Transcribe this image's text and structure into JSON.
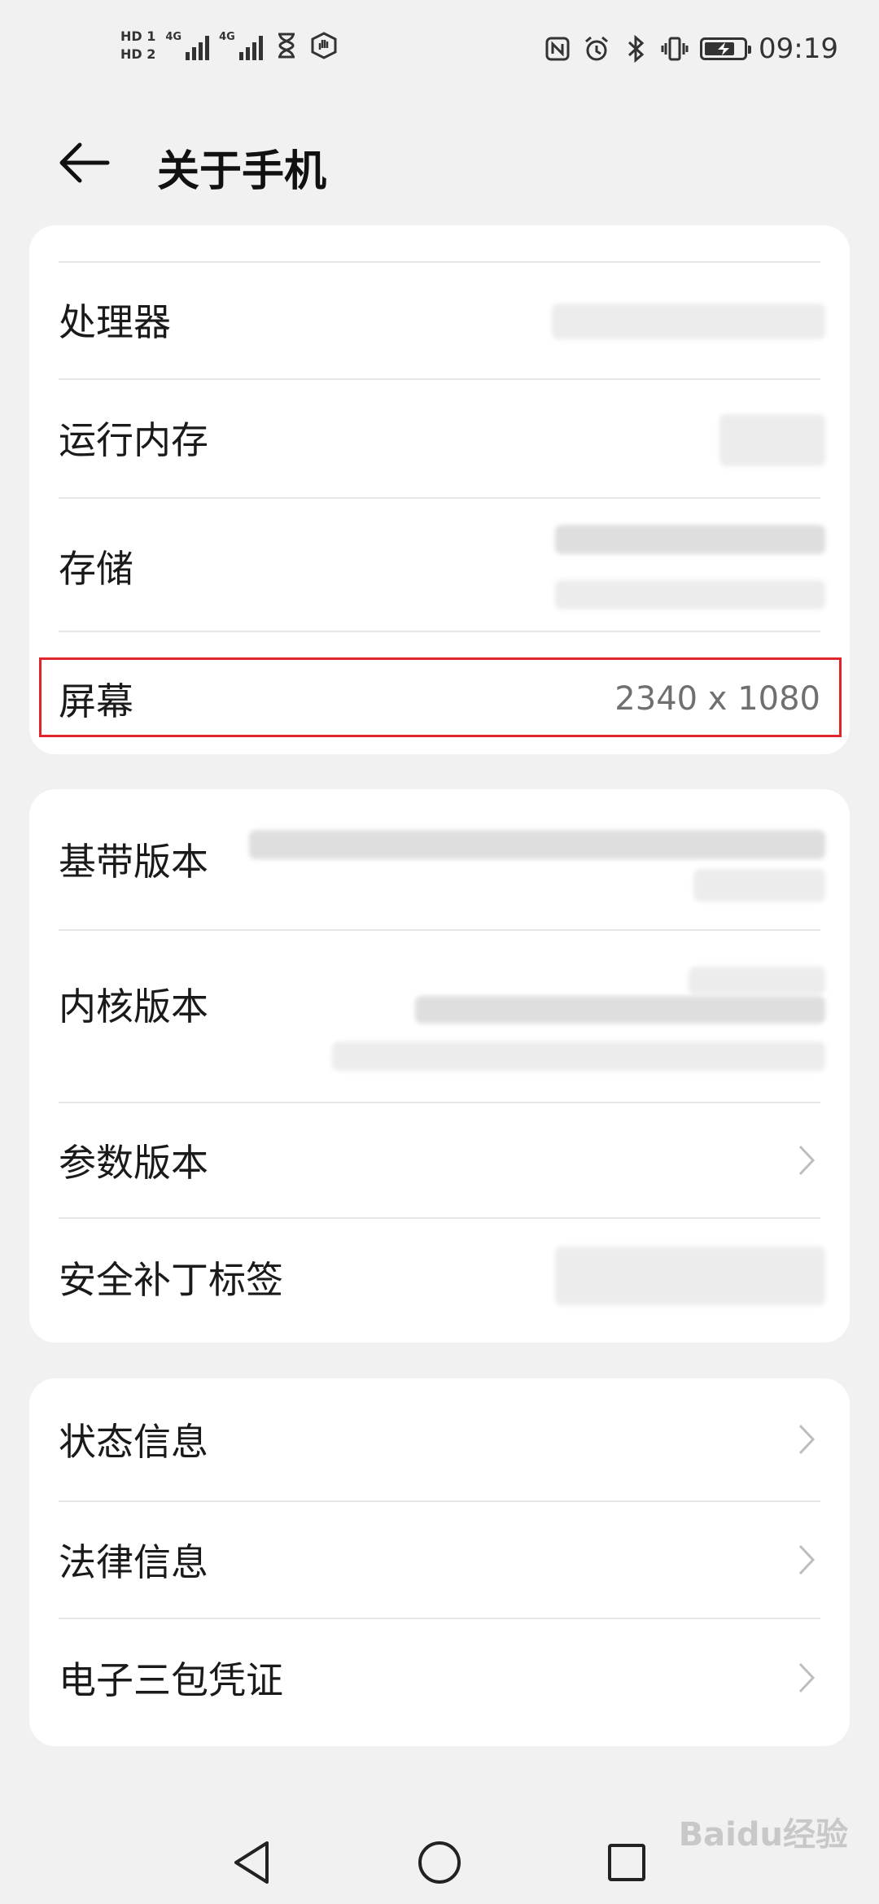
{
  "status_bar": {
    "sim1": "HD 1",
    "sim2": "HD 2",
    "net1": "4G",
    "net2": "4G",
    "time": "09:19",
    "icons": [
      "hourglass-icon",
      "hand-icon",
      "nfc-icon",
      "alarm-icon",
      "bluetooth-icon",
      "vibrate-icon",
      "battery-charging-icon"
    ]
  },
  "header": {
    "title": "关于手机",
    "back_icon": "arrow-left-icon"
  },
  "card1": {
    "items": [
      {
        "label": "处理器"
      },
      {
        "label": "运行内存"
      },
      {
        "label": "存储"
      },
      {
        "label": "屏幕",
        "value": "2340 x 1080"
      }
    ]
  },
  "card2": {
    "items": [
      {
        "label": "基带版本"
      },
      {
        "label": "内核版本"
      },
      {
        "label": "参数版本",
        "has_chevron": true
      },
      {
        "label": "安全补丁标签"
      }
    ]
  },
  "card3": {
    "items": [
      {
        "label": "状态信息",
        "has_chevron": true
      },
      {
        "label": "法律信息",
        "has_chevron": true
      },
      {
        "label": "电子三包凭证",
        "has_chevron": true
      }
    ]
  },
  "nav": {
    "icons": [
      "back-triangle-icon",
      "home-circle-icon",
      "recents-square-icon"
    ]
  },
  "watermark": "Baidu经验",
  "colors": {
    "highlight": "#e0262b",
    "background": "#f1f1f1",
    "card": "#ffffff"
  }
}
